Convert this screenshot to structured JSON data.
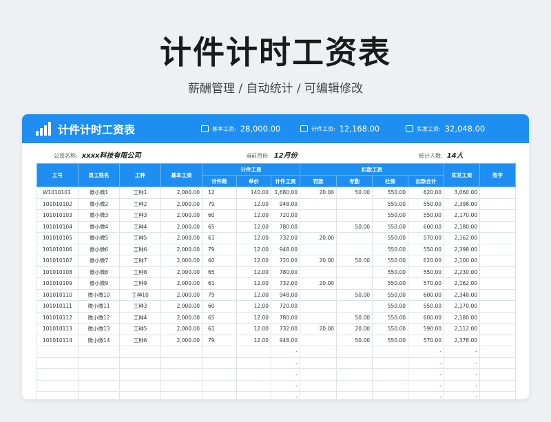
{
  "page": {
    "title": "计件计时工资表",
    "subtitle": "薪酬管理 / 自动统计 / 可编辑修改"
  },
  "header": {
    "title": "计件计时工资表",
    "stats": [
      {
        "icon": "chart-icon",
        "label": "基本工资:",
        "value": "28,000.00"
      },
      {
        "icon": "monitor-icon",
        "label": "计件工资:",
        "value": "12,168.00"
      },
      {
        "icon": "wallet-icon",
        "label": "实发工资:",
        "value": "32,048.00"
      }
    ]
  },
  "info": {
    "company_label": "公司名称:",
    "company_value": "xxxx科技有限公司",
    "month_label": "当前月份:",
    "month_value": "12月份",
    "count_label": "统计人数:",
    "count_value": "14人"
  },
  "columns": {
    "id": "工号",
    "name": "员工姓名",
    "type": "工种",
    "base": "基本工资",
    "piece_group": "计件工资",
    "piece_count": "计件数",
    "unit_price": "单价",
    "piece_wage": "计件工资",
    "deduct_group": "扣款工资",
    "penalty": "罚款",
    "attendance": "考勤",
    "social": "社保",
    "deduct_total": "扣款合计",
    "net": "实发工资",
    "sign": "签字"
  },
  "rows": [
    [
      "W1010101",
      "微小微1",
      "工种1",
      "2,000.00",
      "12",
      "140.00",
      "1,680.00",
      "20.00",
      "50.00",
      "550.00",
      "620.00",
      "3,060.00",
      ""
    ],
    [
      "101010102",
      "微小微2",
      "工种2",
      "2,000.00",
      "79",
      "12.00",
      "948.00",
      "",
      "",
      "550.00",
      "550.00",
      "2,398.00",
      ""
    ],
    [
      "101010103",
      "微小微3",
      "工种3",
      "2,000.00",
      "60",
      "12.00",
      "720.00",
      "",
      "",
      "550.00",
      "550.00",
      "2,170.00",
      ""
    ],
    [
      "101010104",
      "微小微4",
      "工种4",
      "2,000.00",
      "65",
      "12.00",
      "780.00",
      "",
      "50.00",
      "550.00",
      "600.00",
      "2,180.00",
      ""
    ],
    [
      "101010105",
      "微小微5",
      "工种5",
      "2,000.00",
      "61",
      "12.00",
      "732.00",
      "20.00",
      "",
      "550.00",
      "570.00",
      "2,162.00",
      ""
    ],
    [
      "101010106",
      "微小微6",
      "工种6",
      "2,000.00",
      "79",
      "12.00",
      "948.00",
      "",
      "",
      "550.00",
      "550.00",
      "2,398.00",
      ""
    ],
    [
      "101010107",
      "微小微7",
      "工种7",
      "2,000.00",
      "60",
      "12.00",
      "720.00",
      "20.00",
      "50.00",
      "550.00",
      "620.00",
      "2,100.00",
      ""
    ],
    [
      "101010108",
      "微小微8",
      "工种8",
      "2,000.00",
      "65",
      "12.00",
      "780.00",
      "",
      "",
      "550.00",
      "550.00",
      "2,230.00",
      ""
    ],
    [
      "101010109",
      "微小微9",
      "工种9",
      "2,000.00",
      "61",
      "12.00",
      "732.00",
      "20.00",
      "",
      "550.00",
      "570.00",
      "2,162.00",
      ""
    ],
    [
      "101010110",
      "微小微10",
      "工种10",
      "2,000.00",
      "79",
      "12.00",
      "948.00",
      "",
      "50.00",
      "550.00",
      "600.00",
      "2,348.00",
      ""
    ],
    [
      "101010111",
      "微小微11",
      "工种3",
      "2,000.00",
      "60",
      "12.00",
      "720.00",
      "",
      "",
      "550.00",
      "550.00",
      "2,170.00",
      ""
    ],
    [
      "101010112",
      "微小微12",
      "工种4",
      "2,000.00",
      "65",
      "12.00",
      "780.00",
      "",
      "50.00",
      "550.00",
      "600.00",
      "2,180.00",
      ""
    ],
    [
      "101010113",
      "微小微13",
      "工种5",
      "2,000.00",
      "61",
      "12.00",
      "732.00",
      "20.00",
      "20.00",
      "550.00",
      "590.00",
      "2,112.00",
      ""
    ],
    [
      "101010114",
      "微小微14",
      "工种6",
      "2,000.00",
      "79",
      "12.00",
      "948.00",
      "",
      "50.00",
      "550.00",
      "570.00",
      "2,378.00",
      ""
    ],
    [
      "",
      "",
      "",
      "",
      "",
      "",
      "-",
      "",
      "",
      "",
      "-",
      "-",
      ""
    ],
    [
      "",
      "",
      "",
      "",
      "",
      "",
      "-",
      "",
      "",
      "",
      "-",
      "-",
      ""
    ],
    [
      "",
      "",
      "",
      "",
      "",
      "",
      "-",
      "",
      "",
      "",
      "-",
      "-",
      ""
    ],
    [
      "",
      "",
      "",
      "",
      "",
      "",
      "-",
      "",
      "",
      "",
      "-",
      "-",
      ""
    ],
    [
      "",
      "",
      "",
      "",
      "",
      "",
      "-",
      "",
      "",
      "",
      "-",
      "-",
      ""
    ]
  ],
  "colors": {
    "accent": "#1e8ff0",
    "background": "#eef0f4"
  }
}
